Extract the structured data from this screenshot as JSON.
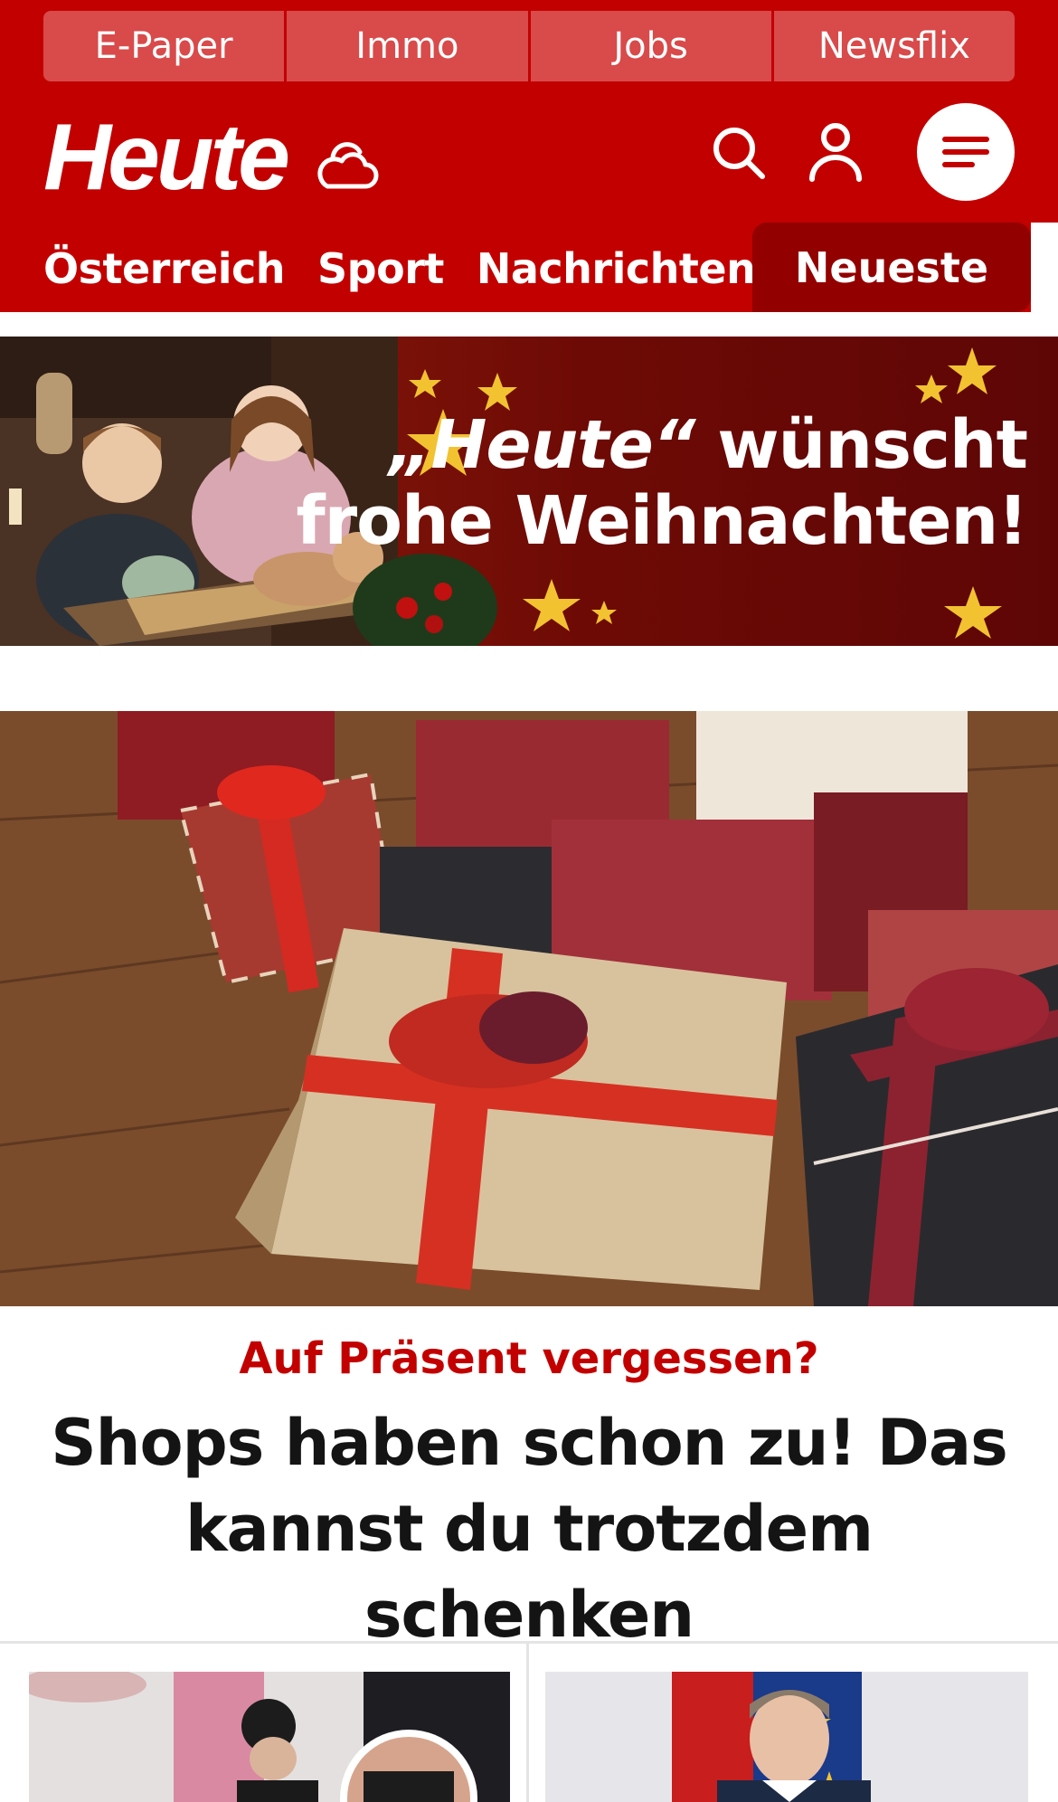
{
  "top_links": [
    "E-Paper",
    "Immo",
    "Jobs",
    "Newsflix"
  ],
  "brand": {
    "logo_text": "Heute"
  },
  "icons": {
    "weather": "cloud-sun-icon",
    "search": "search-icon",
    "account": "user-icon",
    "menu": "hamburger-menu-icon"
  },
  "nav": {
    "items": [
      "Österreich",
      "Sport",
      "Nachrichten"
    ],
    "active_tab": "Neueste"
  },
  "banner": {
    "line1_quoted": "„Heute“",
    "line1_rest": " wünscht",
    "line2": "frohe Weihnachten!"
  },
  "teaser": {
    "kicker": "Auf Präsent vergessen?",
    "headline": "Shops haben schon zu! Das kannst du trotzdem schenken"
  },
  "colors": {
    "brand_red": "#c30000",
    "nav_active": "#930000",
    "toplink_bg": "#d94a4a",
    "kicker": "#c30000"
  }
}
